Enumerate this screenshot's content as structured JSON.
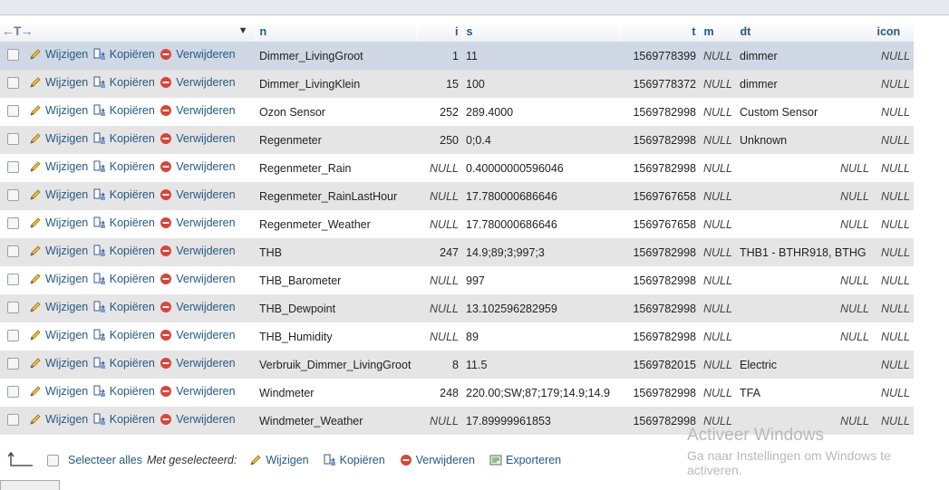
{
  "header": {
    "cols": [
      "n",
      "i",
      "s",
      "t",
      "m",
      "dt",
      "icon"
    ]
  },
  "actions": {
    "edit": "Wijzigen",
    "copy": "Kopiëren",
    "delete": "Verwijderen",
    "export": "Exporteren"
  },
  "rows": [
    {
      "n": "Dimmer_LivingGroot",
      "i": "1",
      "s": "11",
      "t": "1569778399",
      "m": "NULL",
      "dt": "dimmer",
      "dt_null": false,
      "icon": "NULL",
      "i_null": false
    },
    {
      "n": "Dimmer_LivingKlein",
      "i": "15",
      "s": "100",
      "t": "1569778372",
      "m": "NULL",
      "dt": "dimmer",
      "dt_null": false,
      "icon": "NULL",
      "i_null": false
    },
    {
      "n": "Ozon Sensor",
      "i": "252",
      "s": "289.4000",
      "t": "1569782998",
      "m": "NULL",
      "dt": "Custom Sensor",
      "dt_null": false,
      "icon": "NULL",
      "i_null": false
    },
    {
      "n": "Regenmeter",
      "i": "250",
      "s": "0;0.4",
      "t": "1569782998",
      "m": "NULL",
      "dt": "Unknown",
      "dt_null": false,
      "icon": "NULL",
      "i_null": false
    },
    {
      "n": "Regenmeter_Rain",
      "i": "NULL",
      "s": "0.40000000596046",
      "t": "1569782998",
      "m": "NULL",
      "dt": "NULL",
      "dt_null": true,
      "icon": "NULL",
      "i_null": true
    },
    {
      "n": "Regenmeter_RainLastHour",
      "i": "NULL",
      "s": "17.780000686646",
      "t": "1569767658",
      "m": "NULL",
      "dt": "NULL",
      "dt_null": true,
      "icon": "NULL",
      "i_null": true
    },
    {
      "n": "Regenmeter_Weather",
      "i": "NULL",
      "s": "17.780000686646",
      "t": "1569767658",
      "m": "NULL",
      "dt": "NULL",
      "dt_null": true,
      "icon": "NULL",
      "i_null": true
    },
    {
      "n": "THB",
      "i": "247",
      "s": "14.9;89;3;997;3",
      "t": "1569782998",
      "m": "NULL",
      "dt": "THB1 - BTHR918, BTHG",
      "dt_null": false,
      "icon": "NULL",
      "i_null": false
    },
    {
      "n": "THB_Barometer",
      "i": "NULL",
      "s": "997",
      "t": "1569782998",
      "m": "NULL",
      "dt": "NULL",
      "dt_null": true,
      "icon": "NULL",
      "i_null": true
    },
    {
      "n": "THB_Dewpoint",
      "i": "NULL",
      "s": "13.102596282959",
      "t": "1569782998",
      "m": "NULL",
      "dt": "NULL",
      "dt_null": true,
      "icon": "NULL",
      "i_null": true
    },
    {
      "n": "THB_Humidity",
      "i": "NULL",
      "s": "89",
      "t": "1569782998",
      "m": "NULL",
      "dt": "NULL",
      "dt_null": true,
      "icon": "NULL",
      "i_null": true
    },
    {
      "n": "Verbruik_Dimmer_LivingGroot",
      "i": "8",
      "s": "11.5",
      "t": "1569782015",
      "m": "NULL",
      "dt": "Electric",
      "dt_null": false,
      "icon": "NULL",
      "i_null": false
    },
    {
      "n": "Windmeter",
      "i": "248",
      "s": "220.00;SW;87;179;14.9;14.9",
      "t": "1569782998",
      "m": "NULL",
      "dt": "TFA",
      "dt_null": false,
      "icon": "NULL",
      "i_null": false
    },
    {
      "n": "Windmeter_Weather",
      "i": "NULL",
      "s": "17.89999961853",
      "t": "1569782998",
      "m": "NULL",
      "dt": "NULL",
      "dt_null": true,
      "icon": "NULL",
      "i_null": true
    }
  ],
  "footer": {
    "select_all": "Selecteer alles",
    "with_selected": "Met geselecteerd:"
  },
  "watermark": {
    "line1": "Activeer Windows",
    "line2": "Ga naar Instellingen om Windows te activeren."
  },
  "icons": {
    "edit": "pencil-icon",
    "copy": "copy-icon",
    "delete": "delete-icon",
    "export": "export-icon",
    "up": "up-arrow-icon"
  },
  "colors": {
    "link": "#235a81",
    "row_even": "#e5e5e5",
    "row_marked": "#cfd8e4"
  }
}
